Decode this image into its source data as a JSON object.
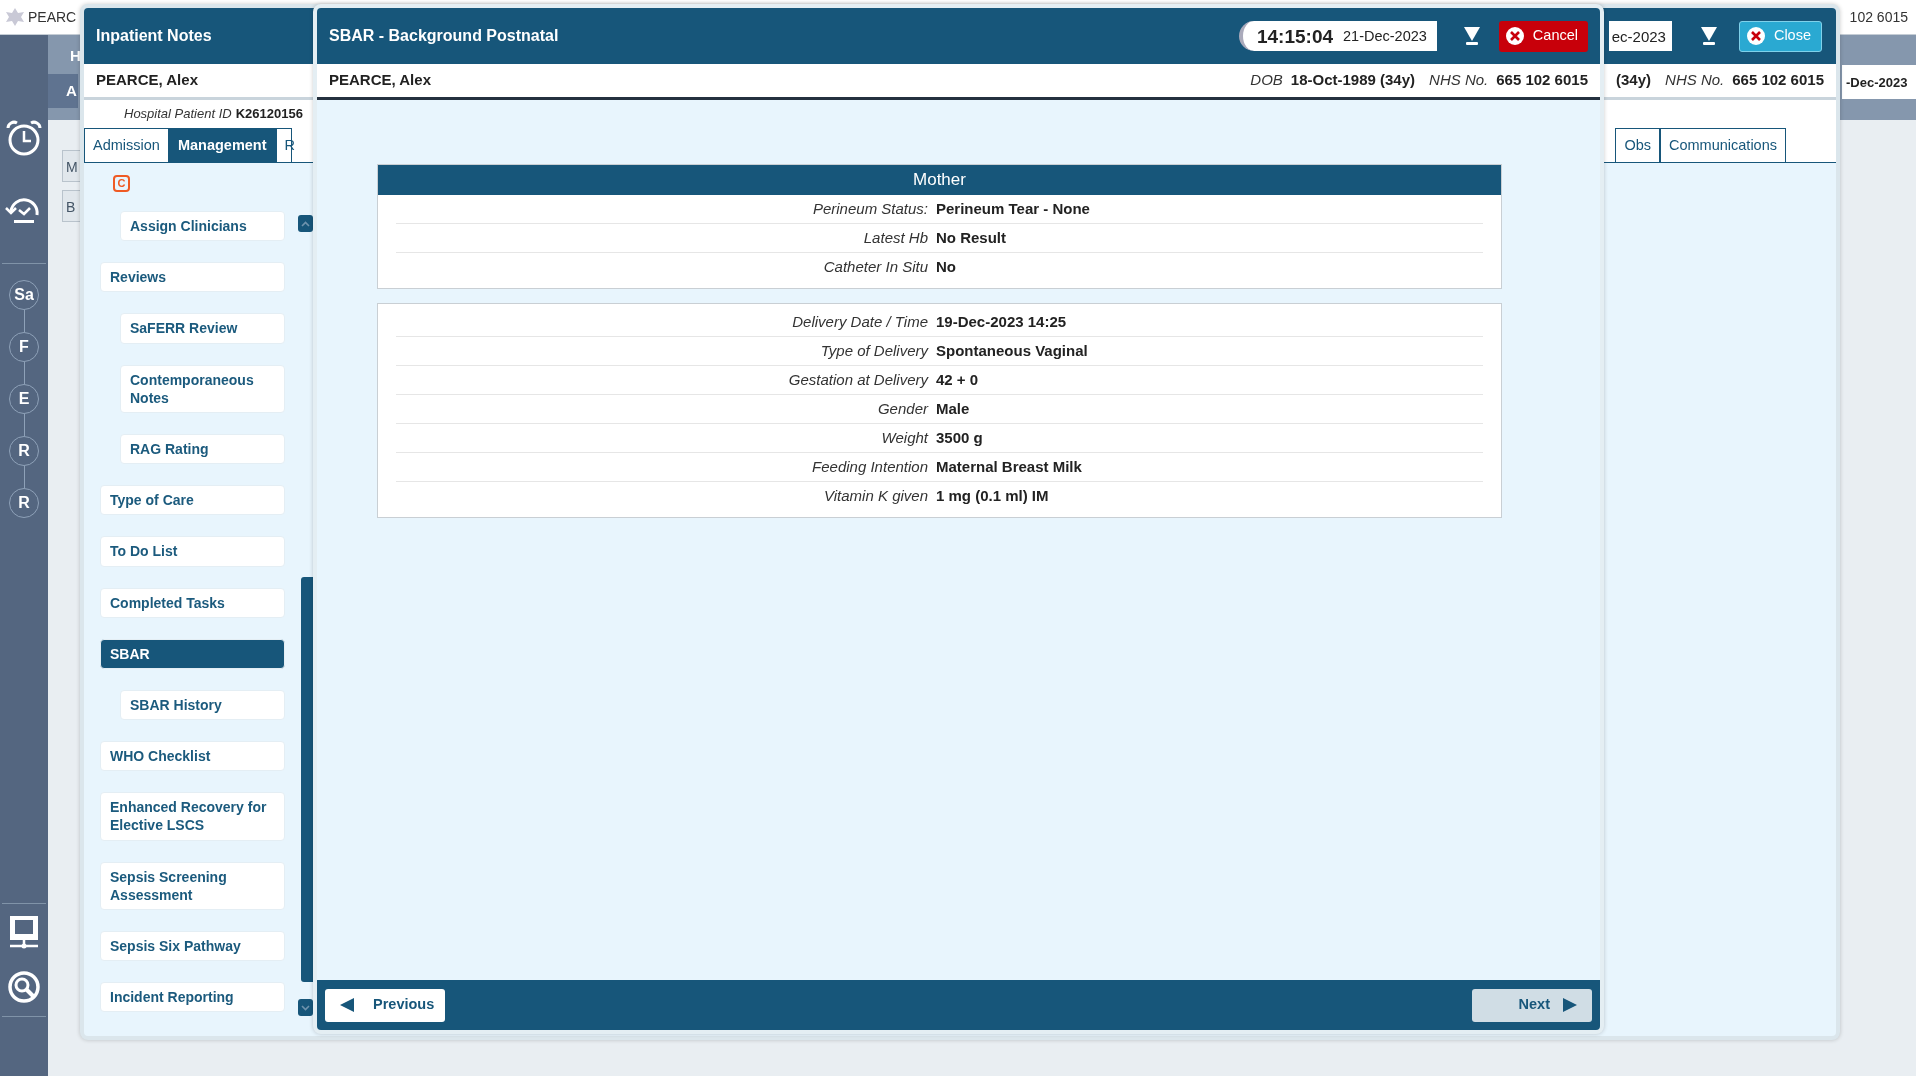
{
  "app": {
    "title": "PEARC",
    "nhs_fragment": "102 6015",
    "date_fragment": "-Dec-2023",
    "header_letters": [
      "H",
      "A"
    ],
    "side_buttons": [
      "M",
      "B"
    ],
    "steps": [
      "Sa",
      "F",
      "E",
      "R",
      "R"
    ]
  },
  "inpatient_window": {
    "title": "Inpatient Notes",
    "date": "ec-2023",
    "close_label": "Close",
    "patient_name": "PEARCE, Alex",
    "dob_value": "(34y)",
    "nhs_label": "NHS No.",
    "nhs_value": "665 102 6015",
    "hospital_id_label": "Hospital Patient ID",
    "hospital_id": "K26120156",
    "tabs": [
      {
        "label": "Admission",
        "selected": false
      },
      {
        "label": "Management",
        "selected": true
      },
      {
        "label": "R",
        "selected": false
      }
    ],
    "tabs_end": [
      {
        "label": "Obs",
        "selected": false
      },
      {
        "label": "Communications",
        "selected": false
      }
    ],
    "nav": {
      "badge": "C",
      "continued_children": [
        {
          "label": "Assign Clinicians",
          "selected": false
        }
      ],
      "items": [
        {
          "label": "Reviews",
          "selected": false,
          "children": [
            {
              "label": "SaFERR Review",
              "selected": false
            },
            {
              "label": "Contemporaneous Notes",
              "selected": false
            },
            {
              "label": "RAG Rating",
              "selected": false
            }
          ]
        },
        {
          "label": "Type of Care",
          "selected": false
        },
        {
          "label": "To Do List",
          "selected": false
        },
        {
          "label": "Completed Tasks",
          "selected": false
        },
        {
          "label": "SBAR",
          "selected": true,
          "children": [
            {
              "label": "SBAR History",
              "selected": false
            }
          ]
        },
        {
          "label": "WHO Checklist",
          "selected": false
        },
        {
          "label": "Enhanced Recovery for Elective LSCS",
          "selected": false
        },
        {
          "label": "Sepsis Screening Assessment",
          "selected": false
        },
        {
          "label": "Sepsis Six Pathway",
          "selected": false
        },
        {
          "label": "Incident Reporting",
          "selected": false
        }
      ]
    }
  },
  "sbar_window": {
    "title": "SBAR - Background Postnatal",
    "time": "14:15:04",
    "date": "21-Dec-2023",
    "cancel_label": "Cancel",
    "patient_name": "PEARCE, Alex",
    "dob_label": "DOB",
    "dob_value": "18-Oct-1989 (34y)",
    "nhs_label": "NHS No.",
    "nhs_value": "665 102 6015",
    "sections": [
      {
        "title": "Mother",
        "rows": [
          {
            "label": "Perineum Status:",
            "value": "Perineum Tear - None"
          },
          {
            "label": "Latest Hb",
            "value": "No Result"
          },
          {
            "label": "Catheter In Situ",
            "value": "No"
          }
        ]
      },
      {
        "rows": [
          {
            "label": "Delivery Date / Time",
            "value": "19-Dec-2023 14:25"
          },
          {
            "label": "Type of Delivery",
            "value": "Spontaneous Vaginal"
          },
          {
            "label": "Gestation at Delivery",
            "value": "42 + 0"
          },
          {
            "label": "Gender",
            "value": "Male"
          },
          {
            "label": "Weight",
            "value": "3500 g"
          },
          {
            "label": "Feeding Intention",
            "value": "Maternal Breast Milk"
          },
          {
            "label": "Vitamin K given",
            "value": "1 mg (0.1 ml) IM"
          }
        ]
      }
    ],
    "previous_label": "Previous",
    "next_label": "Next"
  }
}
